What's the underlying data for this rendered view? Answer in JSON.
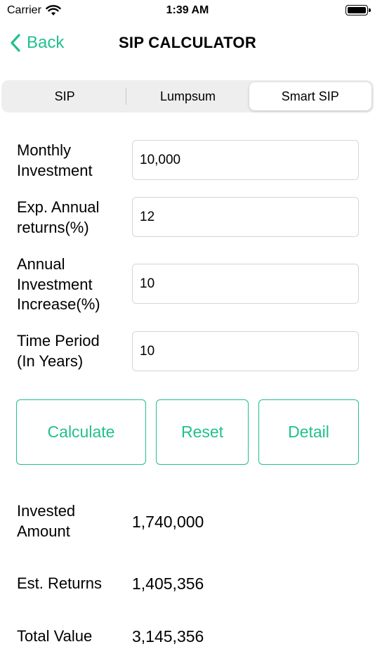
{
  "status_bar": {
    "carrier": "Carrier",
    "time": "1:39 AM"
  },
  "nav": {
    "back_label": "Back",
    "title": "SIP CALCULATOR"
  },
  "tabs": [
    {
      "label": "SIP",
      "selected": false
    },
    {
      "label": "Lumpsum",
      "selected": false
    },
    {
      "label": "Smart SIP",
      "selected": true
    }
  ],
  "form": {
    "monthly_investment": {
      "label_line1": "Monthly",
      "label_line2": "Investment",
      "value": "10,000"
    },
    "annual_returns": {
      "label_line1": "Exp. Annual",
      "label_line2": "returns(%)",
      "value": "12"
    },
    "annual_increase": {
      "label_line1": "Annual",
      "label_line2": "Investment",
      "label_line3": "Increase(%)",
      "value": "10"
    },
    "time_period": {
      "label_line1": "Time Period",
      "label_line2": "(In Years)",
      "value": "10"
    }
  },
  "buttons": {
    "calculate": "Calculate",
    "reset": "Reset",
    "detail": "Detail"
  },
  "results": {
    "invested_amount": {
      "label_line1": "Invested",
      "label_line2": "Amount",
      "value": "1,740,000"
    },
    "est_returns": {
      "label": "Est. Returns",
      "value": "1,405,356"
    },
    "total_value": {
      "label": "Total Value",
      "value": "3,145,356"
    }
  },
  "colors": {
    "accent": "#21c08f",
    "segment_bg": "#eeeeef",
    "input_border": "#d6d6d6"
  }
}
